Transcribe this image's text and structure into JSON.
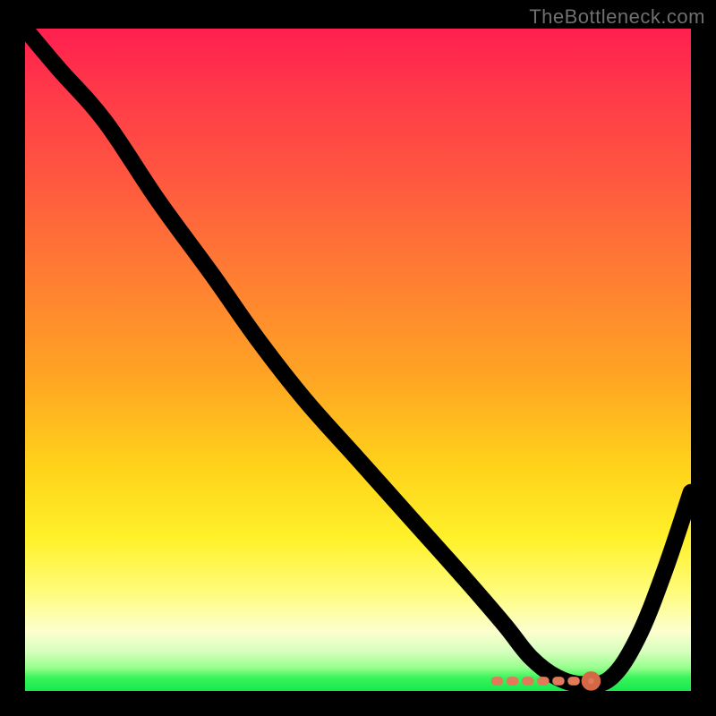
{
  "watermark": "TheBottleneck.com",
  "chart_data": {
    "type": "line",
    "title": "",
    "xlabel": "",
    "ylabel": "",
    "xlim": [
      0,
      100
    ],
    "ylim": [
      0,
      100
    ],
    "grid": false,
    "legend": false,
    "background_gradient": {
      "top": "#ff1f4f",
      "mid_upper": "#ff7a34",
      "mid": "#ffd21a",
      "mid_lower": "#fcffce",
      "bottom": "#17e84e"
    },
    "series": [
      {
        "name": "bottleneck-curve",
        "color": "#000000",
        "x": [
          0,
          5,
          12,
          20,
          28,
          35,
          42,
          50,
          58,
          66,
          72,
          76,
          80,
          84,
          88,
          92,
          96,
          100
        ],
        "values": [
          100,
          94,
          86,
          74,
          63,
          53,
          44,
          35,
          26,
          17,
          10,
          5,
          2,
          1,
          2,
          8,
          18,
          30
        ]
      }
    ],
    "markers": {
      "name": "optimal-range",
      "type": "band",
      "color": "#e07a5a",
      "y": 1.5,
      "x_start": 70,
      "x_end": 84,
      "endpoint_dot_x": 85
    }
  }
}
